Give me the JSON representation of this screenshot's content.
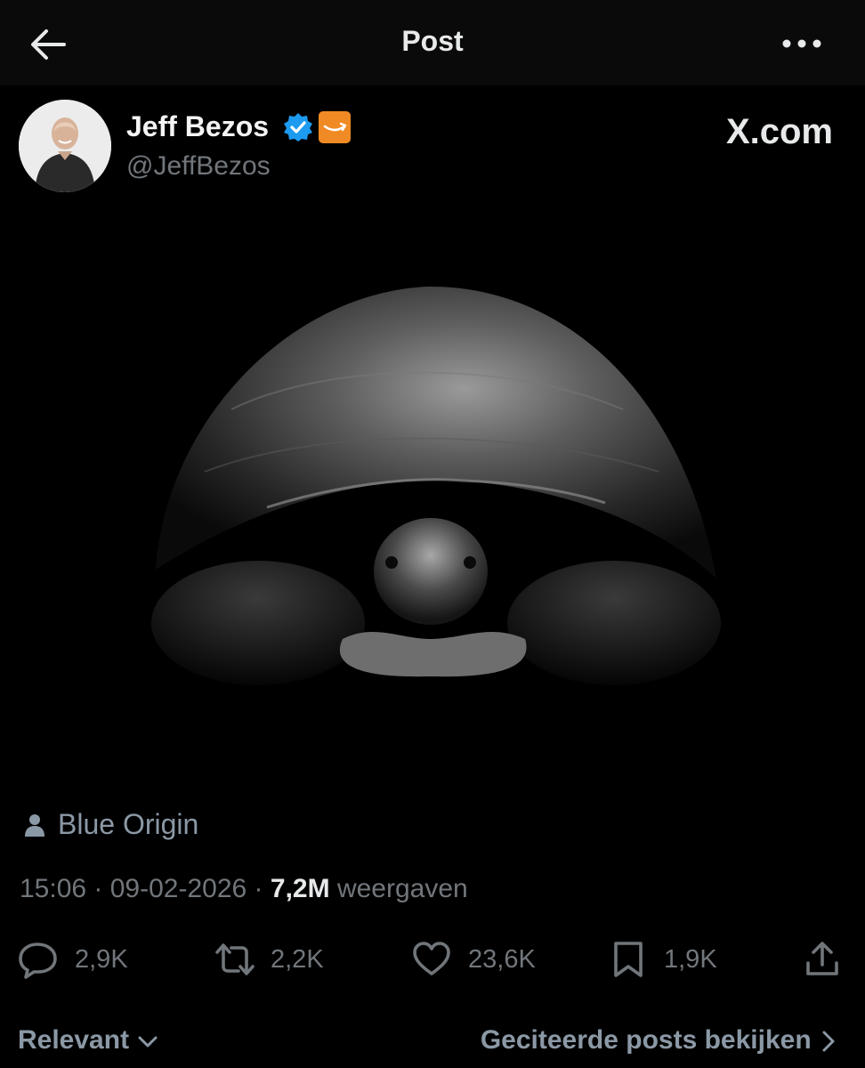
{
  "header": {
    "title": "Post"
  },
  "author": {
    "name": "Jeff Bezos",
    "handle": "@JeffBezos",
    "verified_color": "#1d9bf0",
    "affiliate_badge_color": "#f08a24"
  },
  "watermark": "X.com",
  "location": {
    "icon": "person-icon",
    "label": "Blue Origin"
  },
  "meta": {
    "time": "15:06",
    "separator": " · ",
    "date": "09-02-2026",
    "views_count": "7,2M",
    "views_label": "weergaven"
  },
  "actions": {
    "replies": {
      "icon": "reply-icon",
      "count": "2,9K"
    },
    "reposts": {
      "icon": "repost-icon",
      "count": "2,2K"
    },
    "likes": {
      "icon": "heart-icon",
      "count": "23,6K"
    },
    "bookmarks": {
      "icon": "bookmark-icon",
      "count": "1,9K"
    },
    "share": {
      "icon": "share-icon"
    }
  },
  "footer": {
    "sort_label": "Relevant",
    "quotes_label": "Geciteerde posts bekijken"
  }
}
